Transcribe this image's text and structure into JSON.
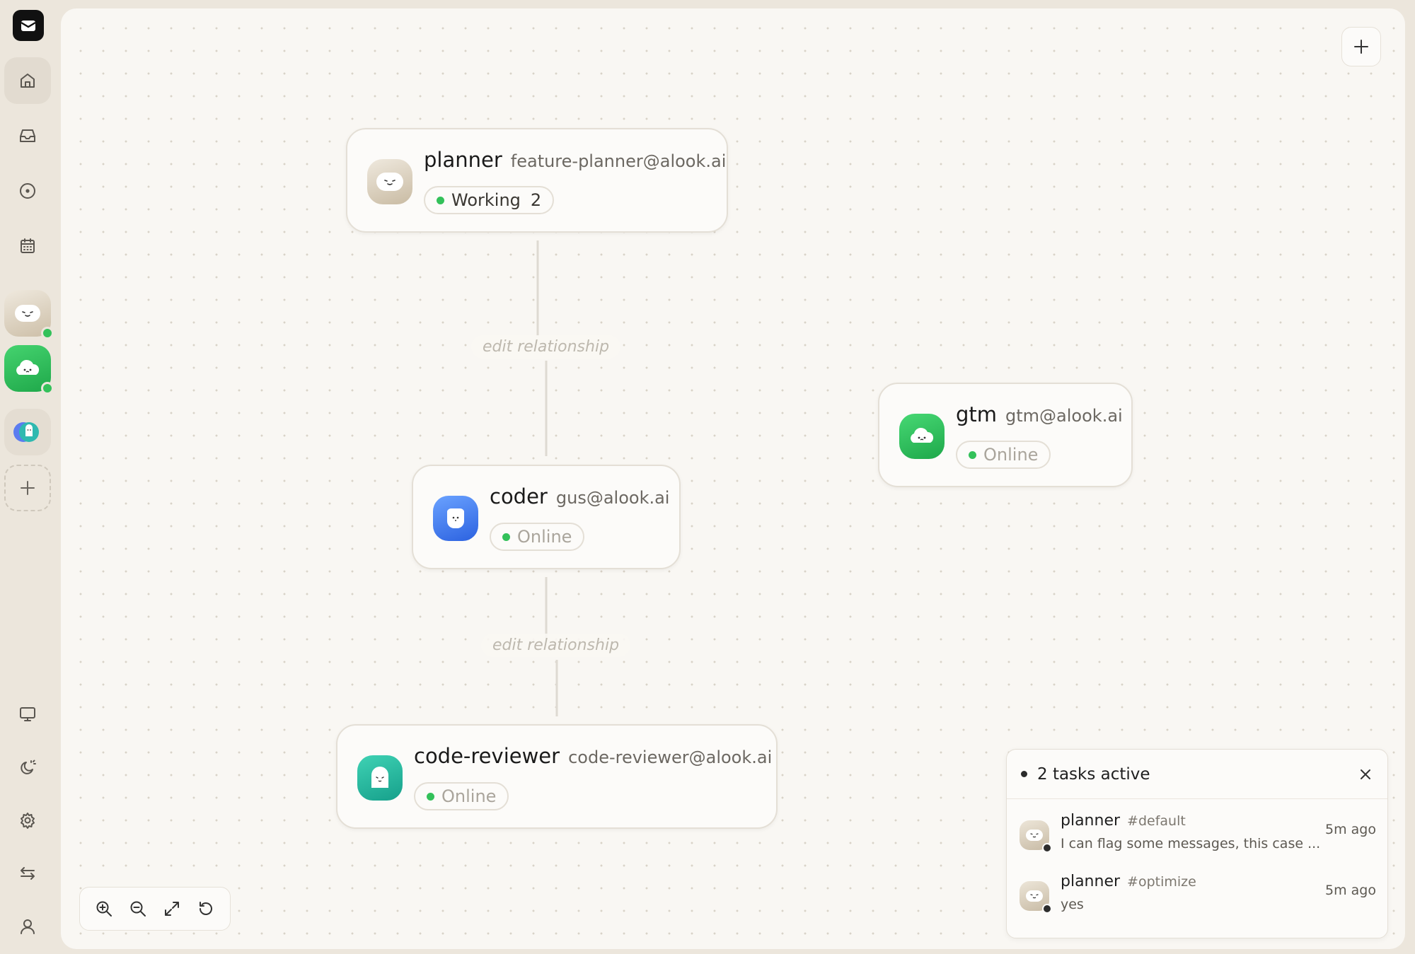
{
  "sidebar": {
    "logo_icon": "mail-logo-icon",
    "nav_icons": [
      "home-icon",
      "inbox-icon",
      "circle-dot-icon",
      "calendar-icon"
    ],
    "bottom_icons": [
      "monitor-icon",
      "theme-icon",
      "gear-icon",
      "transfer-icon",
      "user-icon"
    ],
    "agents": [
      {
        "name": "planner",
        "color": "#d6cbb8",
        "online": true
      },
      {
        "name": "gtm",
        "color": "#2fbe5c",
        "online": true
      },
      {
        "name": "workspace",
        "color": "#3fb6c4",
        "online": false
      }
    ]
  },
  "nodes": {
    "planner": {
      "name": "planner",
      "email": "feature-planner@alook.ai",
      "status": "Working",
      "count": "2"
    },
    "coder": {
      "name": "coder",
      "email": "gus@alook.ai",
      "status": "Online"
    },
    "reviewer": {
      "name": "code-reviewer",
      "email": "code-reviewer@alook.ai",
      "status": "Online"
    },
    "gtm": {
      "name": "gtm",
      "email": "gtm@alook.ai",
      "status": "Online"
    }
  },
  "edges": {
    "label_1": "edit relationship",
    "label_2": "edit relationship"
  },
  "tasks": {
    "title": "2 tasks active",
    "items": [
      {
        "name": "planner",
        "channel": "#default",
        "message": "I can flag some messages, this case ...",
        "time": "5m ago"
      },
      {
        "name": "planner",
        "channel": "#optimize",
        "message": "yes",
        "time": "5m ago"
      }
    ]
  },
  "colors": {
    "online": "#33c15a",
    "canvas_bg": "#f9f7f3",
    "sidebar_bg": "#ece6dc"
  }
}
